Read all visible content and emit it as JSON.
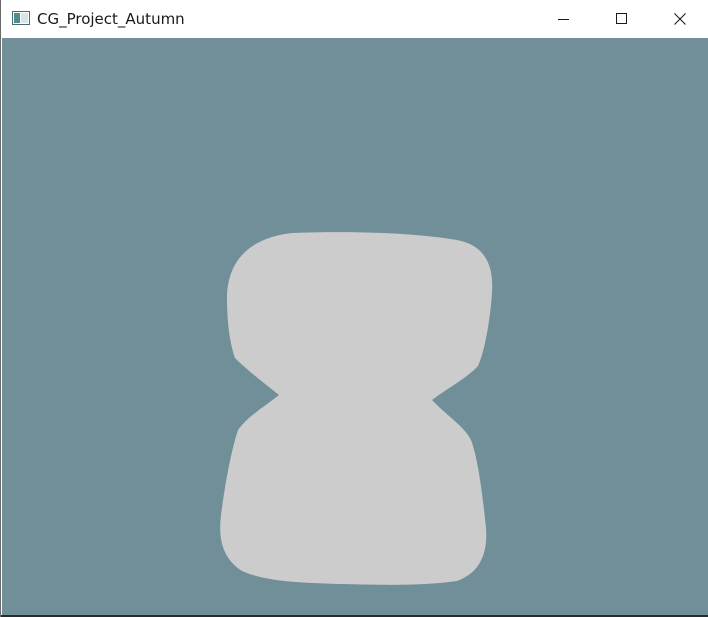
{
  "window": {
    "title": "CG_Project_Autumn",
    "app_icon": "app-window-icon",
    "controls": {
      "minimize_icon": "minimize-icon",
      "maximize_icon": "maximize-icon",
      "close_icon": "close-icon"
    }
  },
  "viewport": {
    "background_color": "#708f99",
    "shape_color": "#cccccc",
    "shape": "rounded-hourglass-silhouette"
  }
}
